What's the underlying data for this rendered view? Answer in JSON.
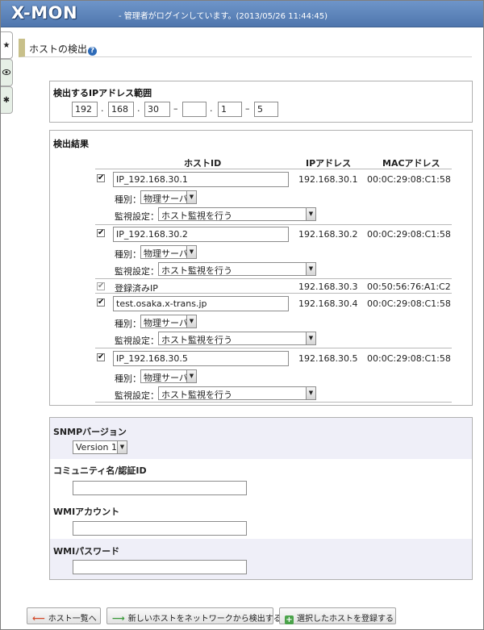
{
  "header": {
    "logo": "X-MON",
    "login_status": "- 管理者がログインしています。(2013/05/26 11:44:45)"
  },
  "rail": {
    "tab1_icon": "star-icon",
    "tab2_icon": "eye-icon",
    "tab3_icon": "gear-icon"
  },
  "page": {
    "title": "ホストの検出",
    "help": "?"
  },
  "ip_range": {
    "title": "検出するIPアドレス範囲",
    "start": [
      "192",
      "168",
      "30",
      ""
    ],
    "end": [
      "1",
      "5"
    ],
    "dot": ".",
    "dash": "–"
  },
  "results": {
    "title": "検出結果",
    "col_hostid": "ホストID",
    "col_ip": "IPアドレス",
    "col_mac": "MACアドレス",
    "type_label": "種別：",
    "monitor_label": "監視設定：",
    "check": "✔",
    "rows": [
      {
        "host_id": "IP_192.168.30.1",
        "ip": "192.168.30.1",
        "mac": "00:0C:29:08:C1:58",
        "type": "物理サーバ",
        "monitor": "ホスト監視を行う"
      },
      {
        "host_id": "IP_192.168.30.2",
        "ip": "192.168.30.2",
        "mac": "00:0C:29:08:C1:58",
        "type": "物理サーバ",
        "monitor": "ホスト監視を行う"
      },
      {
        "host_id": "登録済みIP",
        "ip": "192.168.30.3",
        "mac": "00:50:56:76:A1:C2"
      },
      {
        "host_id": "test.osaka.x-trans.jp",
        "ip": "192.168.30.4",
        "mac": "00:0C:29:08:C1:58",
        "type": "物理サーバ",
        "monitor": "ホスト監視を行う"
      },
      {
        "host_id": "IP_192.168.30.5",
        "ip": "192.168.30.5",
        "mac": "00:0C:29:08:C1:58",
        "type": "物理サーバ",
        "monitor": "ホスト監視を行う"
      }
    ]
  },
  "snmp": {
    "label": "SNMPバージョン",
    "value": "Version 1"
  },
  "community": {
    "label": "コミュニティ名/認証ID",
    "value": ""
  },
  "wmi_account": {
    "label": "WMIアカウント",
    "value": ""
  },
  "wmi_password": {
    "label": "WMIパスワード",
    "value": ""
  },
  "buttons": {
    "back": "ホスト一覧へ",
    "detect_new": "新しいホストをネットワークから検出する",
    "register": "選択したホストを登録する"
  }
}
